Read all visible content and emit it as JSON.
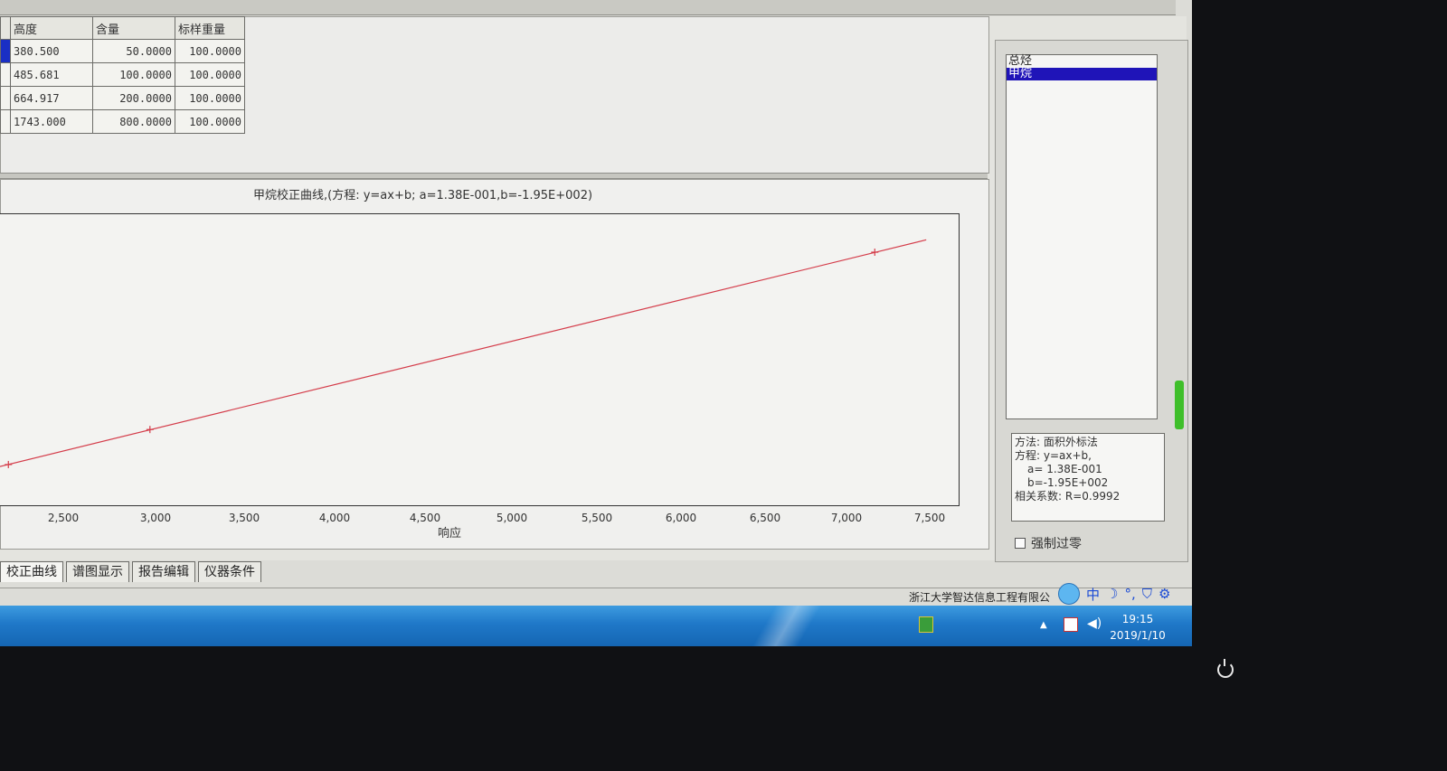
{
  "table": {
    "headers": [
      "高度",
      "含量",
      "标样重量"
    ],
    "rows": [
      [
        "380.500",
        "50.0000",
        "100.0000"
      ],
      [
        "485.681",
        "100.0000",
        "100.0000"
      ],
      [
        "664.917",
        "200.0000",
        "100.0000"
      ],
      [
        "1743.000",
        "800.0000",
        "100.0000"
      ]
    ]
  },
  "chart_data": {
    "type": "line",
    "title": "甲烷校正曲线,(方程: y=ax+b; a=1.38E-001,b=-1.95E+002)",
    "xlabel": "响应",
    "ylabel": "",
    "xticks": [
      "2,500",
      "3,000",
      "3,500",
      "4,000",
      "4,500",
      "5,000",
      "5,500",
      "6,000",
      "6,500",
      "7,000",
      "7,500"
    ],
    "xlim": [
      2000,
      7500
    ],
    "ylim": [
      0,
      900
    ],
    "grid": false,
    "points": [
      {
        "x": 2183,
        "y": 106
      },
      {
        "x": 3000,
        "y": 220
      },
      {
        "x": 7183,
        "y": 797
      }
    ],
    "fit_line": {
      "a": 0.138,
      "b": -195
    }
  },
  "component_list": {
    "items": [
      "总烃",
      "甲烷"
    ],
    "selected": 1
  },
  "info": {
    "method": "方法: 面积外标法",
    "equation": "方程: y=ax+b,",
    "a": "a= 1.38E-001",
    "b": "b=-1.95E+002",
    "r": "相关系数: R=0.9992"
  },
  "force_zero_label": "强制过零",
  "tabs": [
    "校正曲线",
    "谱图显示",
    "报告编辑",
    "仪器条件"
  ],
  "status": {
    "company": "浙江大学智达信息工程有限公"
  },
  "tray": {
    "ime": "中",
    "moon": "☽",
    "dots": "°,",
    "shirt": "⛉",
    "gear": "⚙"
  },
  "clock": {
    "time": "19:15",
    "date": "2019/1/10"
  },
  "colors": {
    "curve": "#d43c4a",
    "selection": "#1f14b8",
    "taskbar": "#1f78c8"
  }
}
